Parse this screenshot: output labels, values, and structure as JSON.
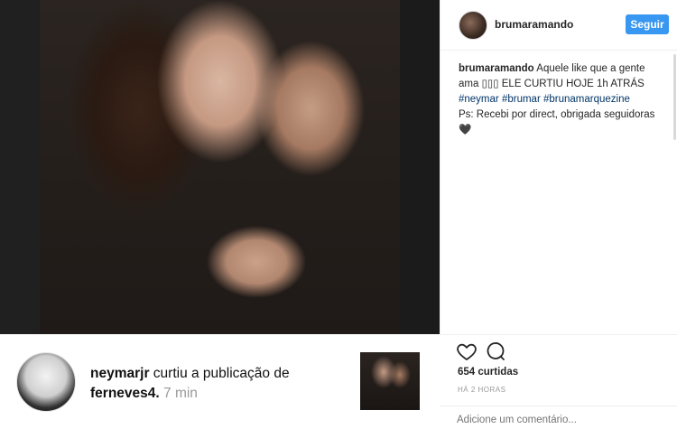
{
  "header": {
    "username": "brumaramando",
    "follow_label": "Seguir",
    "avatar": "profile-avatar"
  },
  "caption": {
    "username": "brumaramando",
    "text_1": "Aquele like que a gente ama ▯▯▯ ELE CURTIU HOJE 1h ATRÁS",
    "tag_1": "#neymar",
    "tag_2": "#brumar",
    "tag_3": "#brunamarquezine",
    "text_2": "Ps: Recebi por direct, obrigada seguidoras",
    "emoji": "🖤"
  },
  "actions": {
    "likes": "654 curtidas",
    "time": "HÁ 2 HORAS",
    "comment_placeholder": "Adicione um comentário..."
  },
  "notification": {
    "user": "neymarjr",
    "text": "curtiu a publicação de",
    "target": "ferneves4.",
    "time": "7 min"
  },
  "colors": {
    "accent": "#3897f0",
    "hashtag": "#003569",
    "muted": "#999999"
  },
  "icons": {
    "like": "heart-icon",
    "comment": "comment-icon"
  }
}
